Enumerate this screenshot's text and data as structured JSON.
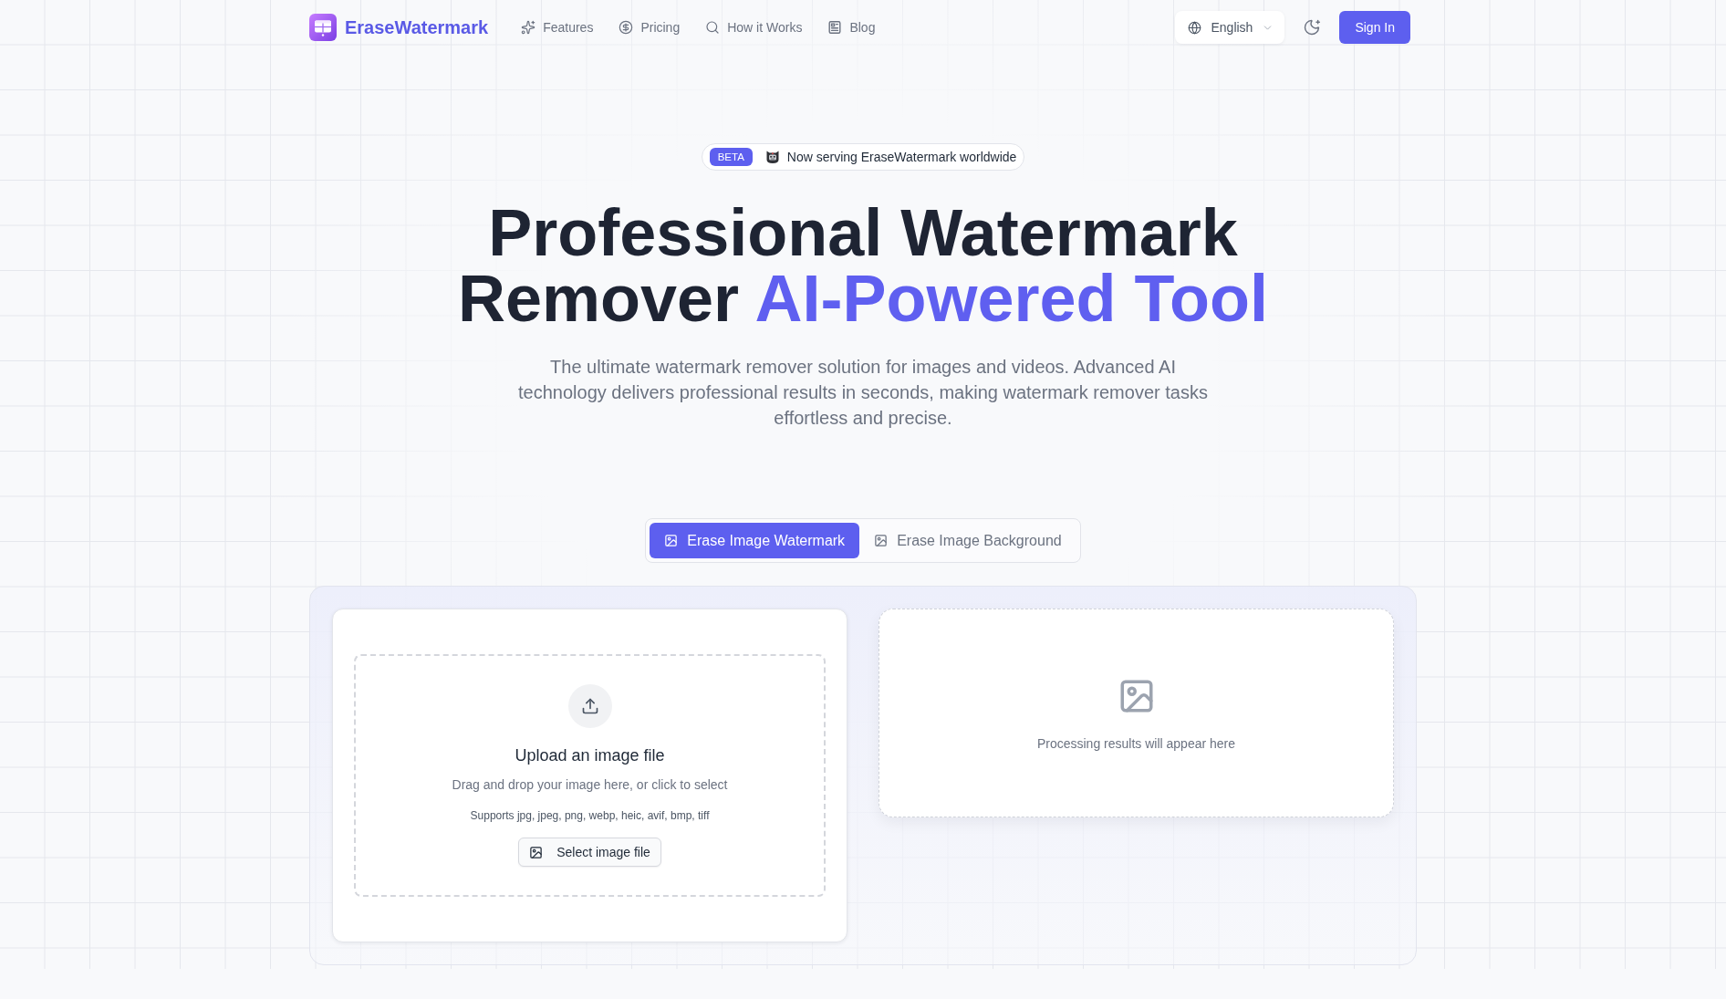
{
  "navbar": {
    "brand": "EraseWatermark",
    "links": [
      "Features",
      "Pricing",
      "How it Works",
      "Blog"
    ],
    "language": "English",
    "sign_in": "Sign In"
  },
  "hero": {
    "badge_tag": "BETA",
    "badge_text": "Now serving EraseWatermark worldwide",
    "title": "Professional Watermark Remover",
    "title_highlight": "AI-Powered Tool",
    "subtitle": "The ultimate watermark remover solution for images and videos. Advanced AI technology delivers professional results in seconds, making watermark remover tasks effortless and precise."
  },
  "mode_tabs": [
    {
      "label": "Erase Image Watermark",
      "selected": true
    },
    {
      "label": "Erase Image Background",
      "selected": false
    }
  ],
  "upload": {
    "title": "Upload an image file",
    "hint": "Drag and drop your image here, or click to select",
    "formats": "Supports jpg, jpeg, png, webp, heic, avif, bmp, tiff",
    "button": "Select image file"
  },
  "result": {
    "message": "Processing results will appear here"
  }
}
